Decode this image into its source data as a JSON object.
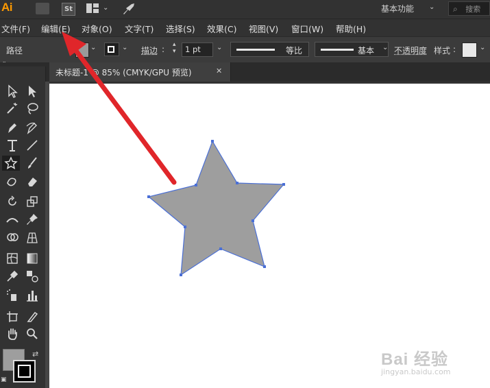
{
  "app": {
    "logo": "Ai",
    "st_label": "St",
    "workspace_label": "基本功能",
    "search_placeholder": "搜索"
  },
  "menu": {
    "items": [
      "文件(F)",
      "编辑(E)",
      "对象(O)",
      "文字(T)",
      "选择(S)",
      "效果(C)",
      "视图(V)",
      "窗口(W)",
      "帮助(H)"
    ]
  },
  "control_bar": {
    "selection_label": "路径",
    "stroke_label": "描边",
    "stroke_weight": "1 pt",
    "profile_label": "等比",
    "brush_label": "基本",
    "opacity_label": "不透明度",
    "style_label": "样式"
  },
  "document": {
    "tab_title": "未标题-1 @ 85% (CMYK/GPU 预览)"
  },
  "watermark": {
    "brand": "Bai 经验",
    "url": "jingyan.baidu.com"
  },
  "colors": {
    "accent_logo": "#ff9a00",
    "fill": "#9e9e9e",
    "selection_path": "#4a6fd6",
    "arrow": "#e0262a"
  }
}
